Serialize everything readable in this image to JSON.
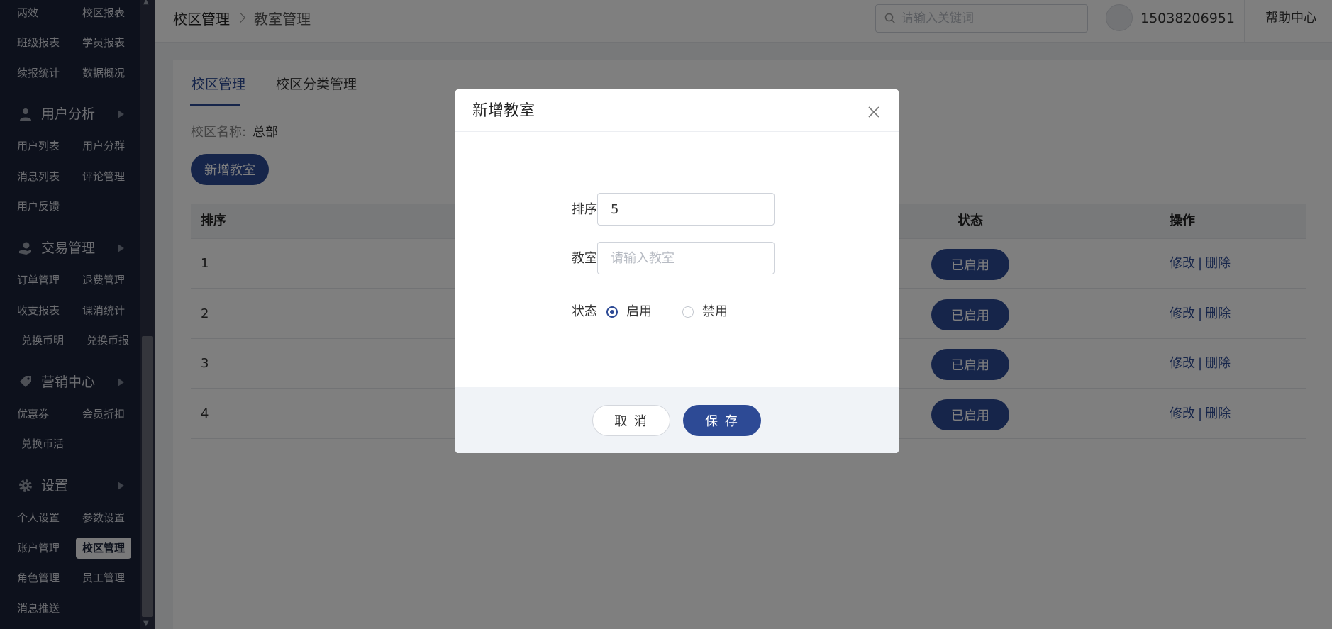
{
  "sidebar": {
    "rows": [
      {
        "a": "两效",
        "b": "校区报表"
      },
      {
        "a": "班级报表",
        "b": "学员报表"
      },
      {
        "a": "续报统计",
        "b": "数据概况"
      }
    ],
    "groups": {
      "user": {
        "label": "用户分析",
        "icon": "user-icon"
      },
      "trade": {
        "label": "交易管理",
        "icon": "hand-coin-icon"
      },
      "marketing": {
        "label": "营销中心",
        "icon": "tag-icon"
      },
      "settings": {
        "label": "设置",
        "icon": "gear-icon"
      }
    },
    "user_items": [
      {
        "a": "用户列表",
        "b": "用户分群"
      },
      {
        "a": "消息列表",
        "b": "评论管理"
      },
      {
        "a": "用户反馈",
        "b": ""
      }
    ],
    "trade_items": [
      {
        "a": "订单管理",
        "b": "退费管理"
      },
      {
        "a": "收支报表",
        "b": "课消统计"
      },
      {
        "a": "兑换币明",
        "b": "兑换币报"
      }
    ],
    "marketing_items": [
      {
        "a": "优惠券",
        "b": "会员折扣"
      },
      {
        "a": "兑换币活",
        "b": ""
      }
    ],
    "settings_items": [
      {
        "a": "个人设置",
        "b": "参数设置"
      },
      {
        "a": "账户管理",
        "b": "校区管理"
      },
      {
        "a": "角色管理",
        "b": "员工管理"
      },
      {
        "a": "消息推送",
        "b": ""
      }
    ]
  },
  "header": {
    "breadcrumb": [
      "校区管理",
      "教室管理"
    ],
    "search_placeholder": "请输入关键词",
    "phone": "15038206951",
    "help": "帮助中心"
  },
  "main": {
    "tabs": [
      "校区管理",
      "校区分类管理"
    ],
    "active_tab": "校区管理",
    "campus_label": "校区名称:",
    "campus_value": "总部",
    "add_button": "新增教室",
    "columns": {
      "order": "排序",
      "status": "状态",
      "ops": "操作"
    },
    "rows": [
      {
        "order": "1",
        "status": "已启用"
      },
      {
        "order": "2",
        "status": "已启用"
      },
      {
        "order": "3",
        "status": "已启用"
      },
      {
        "order": "4",
        "status": "已启用"
      }
    ],
    "edit_label": "修改",
    "op_sep": "|",
    "delete_label": "删除"
  },
  "modal": {
    "title": "新增教室",
    "fields": {
      "order_label": "排序",
      "order_value": "5",
      "room_label": "教室",
      "room_placeholder": "请输入教室",
      "status_label": "状态",
      "status_options": [
        "启用",
        "禁用"
      ],
      "status_selected": "启用"
    },
    "cancel": "取 消",
    "save": "保 存"
  },
  "colors": {
    "primary": "#2d4a95",
    "sidebar_bg": "#1a2238",
    "overlay": "rgba(0,0,0,0.5)"
  }
}
